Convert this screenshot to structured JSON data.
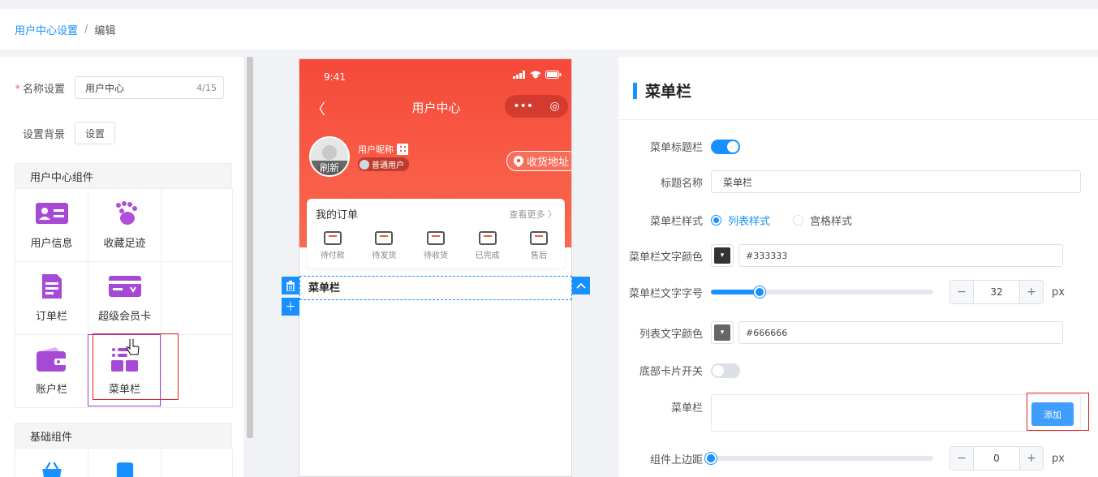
{
  "breadcrumb": {
    "parent": "用户中心设置",
    "separator": "/",
    "current": "编辑"
  },
  "left": {
    "name_label": "名称设置",
    "name_value": "用户中心",
    "name_count": "4/15",
    "bg_label": "设置背景",
    "bg_button": "设置",
    "user_group_title": "用户中心组件",
    "user_components": [
      {
        "label": "用户信息",
        "icon": "id-card-icon"
      },
      {
        "label": "收藏足迹",
        "icon": "footprint-icon"
      },
      {
        "label": "订单栏",
        "icon": "order-list-icon"
      },
      {
        "label": "超级会员卡",
        "icon": "member-card-icon"
      },
      {
        "label": "账户栏",
        "icon": "wallet-icon"
      },
      {
        "label": "菜单栏",
        "icon": "menu-grid-icon"
      }
    ],
    "basic_group_title": "基础组件"
  },
  "phone": {
    "time": "9:41",
    "title": "用户中心",
    "capsule_more": "•••",
    "capsule_close": "◎",
    "refresh": "刷新",
    "nickname": "用户昵称",
    "level": "普通用户",
    "address": "收货地址",
    "orders_title": "我的订单",
    "orders_more": "查看更多",
    "order_items": [
      "待付款",
      "待发货",
      "待收货",
      "已完成",
      "售后"
    ],
    "menu_label": "菜单栏"
  },
  "right": {
    "title": "菜单栏",
    "title_switch_label": "菜单标题栏",
    "title_switch_on": true,
    "title_name_label": "标题名称",
    "title_name_value": "菜单栏",
    "style_label": "菜单栏样式",
    "style_options": [
      "列表样式",
      "宫格样式"
    ],
    "style_selected": "列表样式",
    "text_color_label": "菜单栏文字颜色",
    "text_color": "#333333",
    "font_size_label": "菜单栏文字字号",
    "font_size": "32",
    "font_size_fraction": 0.22,
    "list_color_label": "列表文字颜色",
    "list_color": "#666666",
    "bottom_card_label": "底部卡片开关",
    "bottom_card_on": false,
    "menu_label": "菜单栏",
    "add_button": "添加",
    "margin_label": "组件上边距",
    "margin_value": "0",
    "margin_fraction": 0,
    "unit": "px",
    "stepper_minus": "−",
    "stepper_plus": "+"
  },
  "colors": {
    "accent": "#1890ff",
    "phone_header": "#f5493a",
    "component_icon": "#a64ad6"
  }
}
